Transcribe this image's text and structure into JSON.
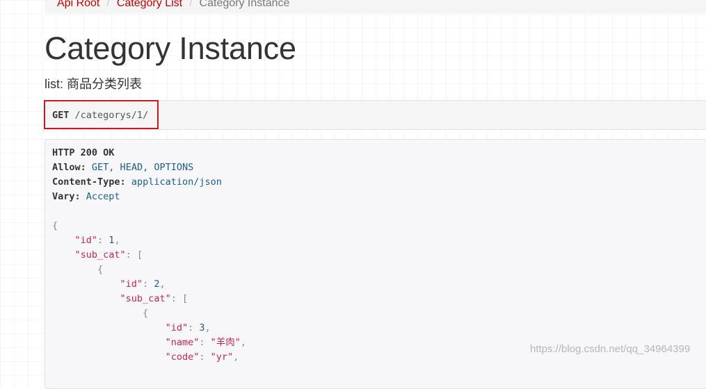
{
  "breadcrumb": {
    "items": [
      {
        "label": "Api Root"
      },
      {
        "label": "Category List"
      },
      {
        "label": "Category Instance"
      }
    ],
    "separator": "/"
  },
  "page": {
    "title": "Category Instance",
    "description": "list: 商品分类列表"
  },
  "request": {
    "method": "GET",
    "path": "/categorys/1/"
  },
  "response": {
    "status": "HTTP 200 OK",
    "headers": [
      {
        "name": "Allow:",
        "value": "GET, HEAD, OPTIONS"
      },
      {
        "name": "Content-Type:",
        "value": "application/json"
      },
      {
        "name": "Vary:",
        "value": "Accept"
      }
    ],
    "body": {
      "open_brace": "{",
      "id_key": "\"id\"",
      "id_val": "1",
      "sub_cat_key": "\"sub_cat\"",
      "open_bracket": "[",
      "item_open_brace": "{",
      "item_id_key": "\"id\"",
      "item_id_val": "2",
      "item_sub_cat_key": "\"sub_cat\"",
      "item_open_bracket": "[",
      "inner_open_brace": "{",
      "inner_id_key": "\"id\"",
      "inner_id_val": "3",
      "inner_name_key": "\"name\"",
      "inner_name_val": "\"羊肉\"",
      "inner_code_key": "\"code\"",
      "inner_code_val": "\"yr\""
    }
  },
  "watermark": "https://blog.csdn.net/qq_34964399"
}
